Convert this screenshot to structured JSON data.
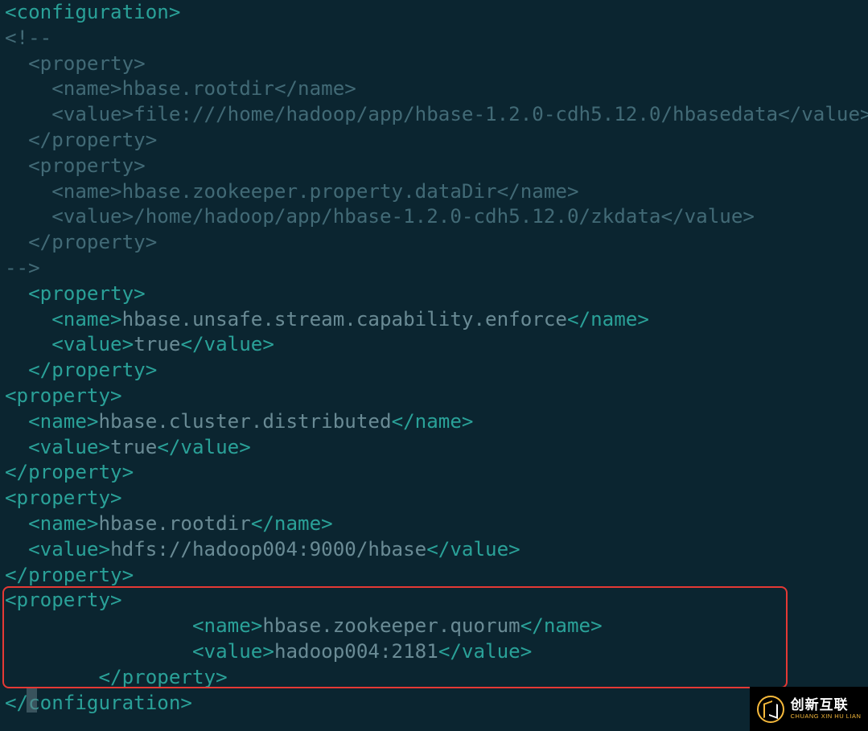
{
  "code": {
    "lines": [
      [
        {
          "c": "tag",
          "t": "<configuration>"
        }
      ],
      [
        {
          "c": "cmt",
          "t": "<!--"
        }
      ],
      [
        {
          "c": "cmt",
          "t": "  "
        },
        {
          "c": "cmt",
          "t": "<property>"
        }
      ],
      [
        {
          "c": "cmt",
          "t": "    "
        },
        {
          "c": "cmt",
          "t": "<name>"
        },
        {
          "c": "cmt",
          "t": "hbase.rootdir"
        },
        {
          "c": "cmt",
          "t": "</name>"
        }
      ],
      [
        {
          "c": "cmt",
          "t": "    "
        },
        {
          "c": "cmt",
          "t": "<value>"
        },
        {
          "c": "cmt",
          "t": "file:///home/hadoop/app/hbase-1.2.0-cdh5.12.0/hbasedata"
        },
        {
          "c": "cmt",
          "t": "</value>"
        }
      ],
      [
        {
          "c": "cmt",
          "t": "  "
        },
        {
          "c": "cmt",
          "t": "</property>"
        }
      ],
      [
        {
          "c": "cmt",
          "t": "  "
        },
        {
          "c": "cmt",
          "t": "<property>"
        }
      ],
      [
        {
          "c": "cmt",
          "t": "    "
        },
        {
          "c": "cmt",
          "t": "<name>"
        },
        {
          "c": "cmt",
          "t": "hbase.zookeeper.property.dataDir"
        },
        {
          "c": "cmt",
          "t": "</name>"
        }
      ],
      [
        {
          "c": "cmt",
          "t": "    "
        },
        {
          "c": "cmt",
          "t": "<value>"
        },
        {
          "c": "cmt",
          "t": "/home/hadoop/app/hbase-1.2.0-cdh5.12.0/zkdata"
        },
        {
          "c": "cmt",
          "t": "</value>"
        }
      ],
      [
        {
          "c": "cmt",
          "t": "  "
        },
        {
          "c": "cmt",
          "t": "</property>"
        }
      ],
      [
        {
          "c": "cmt",
          "t": "-->"
        }
      ],
      [
        {
          "c": "txt",
          "t": "  "
        },
        {
          "c": "tag",
          "t": "<property>"
        }
      ],
      [
        {
          "c": "txt",
          "t": "    "
        },
        {
          "c": "tag",
          "t": "<name>"
        },
        {
          "c": "txt",
          "t": "hbase.unsafe.stream.capability.enforce"
        },
        {
          "c": "tag",
          "t": "</name>"
        }
      ],
      [
        {
          "c": "txt",
          "t": "    "
        },
        {
          "c": "tag",
          "t": "<value>"
        },
        {
          "c": "txt",
          "t": "true"
        },
        {
          "c": "tag",
          "t": "</value>"
        }
      ],
      [
        {
          "c": "txt",
          "t": "  "
        },
        {
          "c": "tag",
          "t": "</property>"
        }
      ],
      [
        {
          "c": "tag",
          "t": "<property>"
        }
      ],
      [
        {
          "c": "txt",
          "t": "  "
        },
        {
          "c": "tag",
          "t": "<name>"
        },
        {
          "c": "txt",
          "t": "hbase.cluster.distributed"
        },
        {
          "c": "tag",
          "t": "</name>"
        }
      ],
      [
        {
          "c": "txt",
          "t": "  "
        },
        {
          "c": "tag",
          "t": "<value>"
        },
        {
          "c": "txt",
          "t": "true"
        },
        {
          "c": "tag",
          "t": "</value>"
        }
      ],
      [
        {
          "c": "tag",
          "t": "</property>"
        }
      ],
      [
        {
          "c": "tag",
          "t": "<property>"
        }
      ],
      [
        {
          "c": "txt",
          "t": "  "
        },
        {
          "c": "tag",
          "t": "<name>"
        },
        {
          "c": "txt",
          "t": "hbase.rootdir"
        },
        {
          "c": "tag",
          "t": "</name>"
        }
      ],
      [
        {
          "c": "txt",
          "t": "  "
        },
        {
          "c": "tag",
          "t": "<value>"
        },
        {
          "c": "txt",
          "t": "hdfs://hadoop004:9000/hbase"
        },
        {
          "c": "tag",
          "t": "</value>"
        }
      ],
      [
        {
          "c": "tag",
          "t": "</property>"
        }
      ],
      [
        {
          "c": "tag",
          "t": "<property>"
        }
      ],
      [
        {
          "c": "txt",
          "t": "                "
        },
        {
          "c": "tag",
          "t": "<name>"
        },
        {
          "c": "txt",
          "t": "hbase.zookeeper.quorum"
        },
        {
          "c": "tag",
          "t": "</name>"
        }
      ],
      [
        {
          "c": "txt",
          "t": "                "
        },
        {
          "c": "tag",
          "t": "<value>"
        },
        {
          "c": "txt",
          "t": "hadoop004:2181"
        },
        {
          "c": "tag",
          "t": "</value>"
        }
      ],
      [
        {
          "c": "txt",
          "t": "        "
        },
        {
          "c": "tag",
          "t": "</property>"
        }
      ],
      [
        {
          "c": "tag",
          "t": "</configuration>"
        }
      ]
    ]
  },
  "watermark": {
    "cn": "创新互联",
    "en": "CHUANG XIN HU LIAN"
  }
}
